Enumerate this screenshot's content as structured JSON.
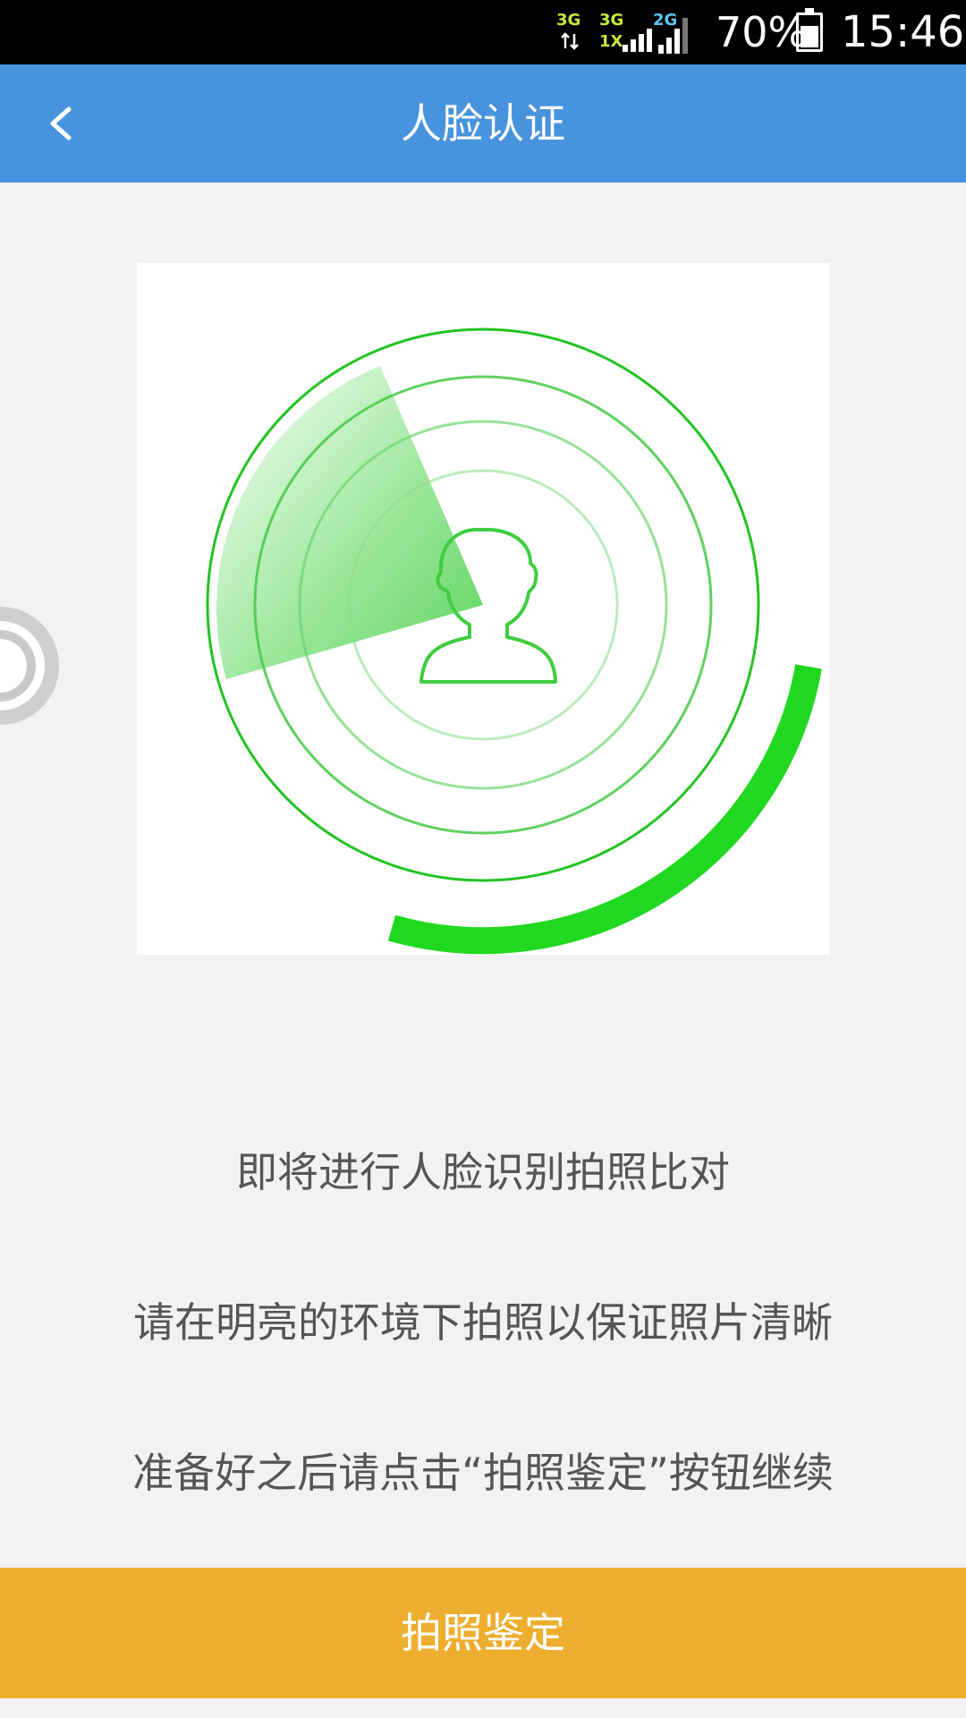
{
  "status_bar": {
    "networks": [
      {
        "label_top": "3G",
        "label_bottom": "",
        "bars": 0
      },
      {
        "label_top": "3G",
        "label_bottom": "1X",
        "bars": 4
      },
      {
        "label_top": "2G",
        "label_bottom": "",
        "bars": 4
      }
    ],
    "battery_percent": "70%",
    "battery_level": 0.7,
    "time": "15:46"
  },
  "app_bar": {
    "back_icon": "chevron-left-icon",
    "title": "人脸认证"
  },
  "illustration": {
    "icon": "face-scan-radar-icon",
    "accent_color": "#1fd81f",
    "ring_color": "#22c322"
  },
  "instructions": {
    "line1": "即将进行人脸识别拍照比对",
    "line2": "请在明亮的环境下拍照以保证照片清晰",
    "line3": "准备好之后请点击“拍照鉴定”按钮继续"
  },
  "action": {
    "label": "拍照鉴定",
    "color": "#edae2f"
  },
  "colors": {
    "app_bar": "#4893dd",
    "background": "#f2f2f2",
    "text": "#555555"
  }
}
